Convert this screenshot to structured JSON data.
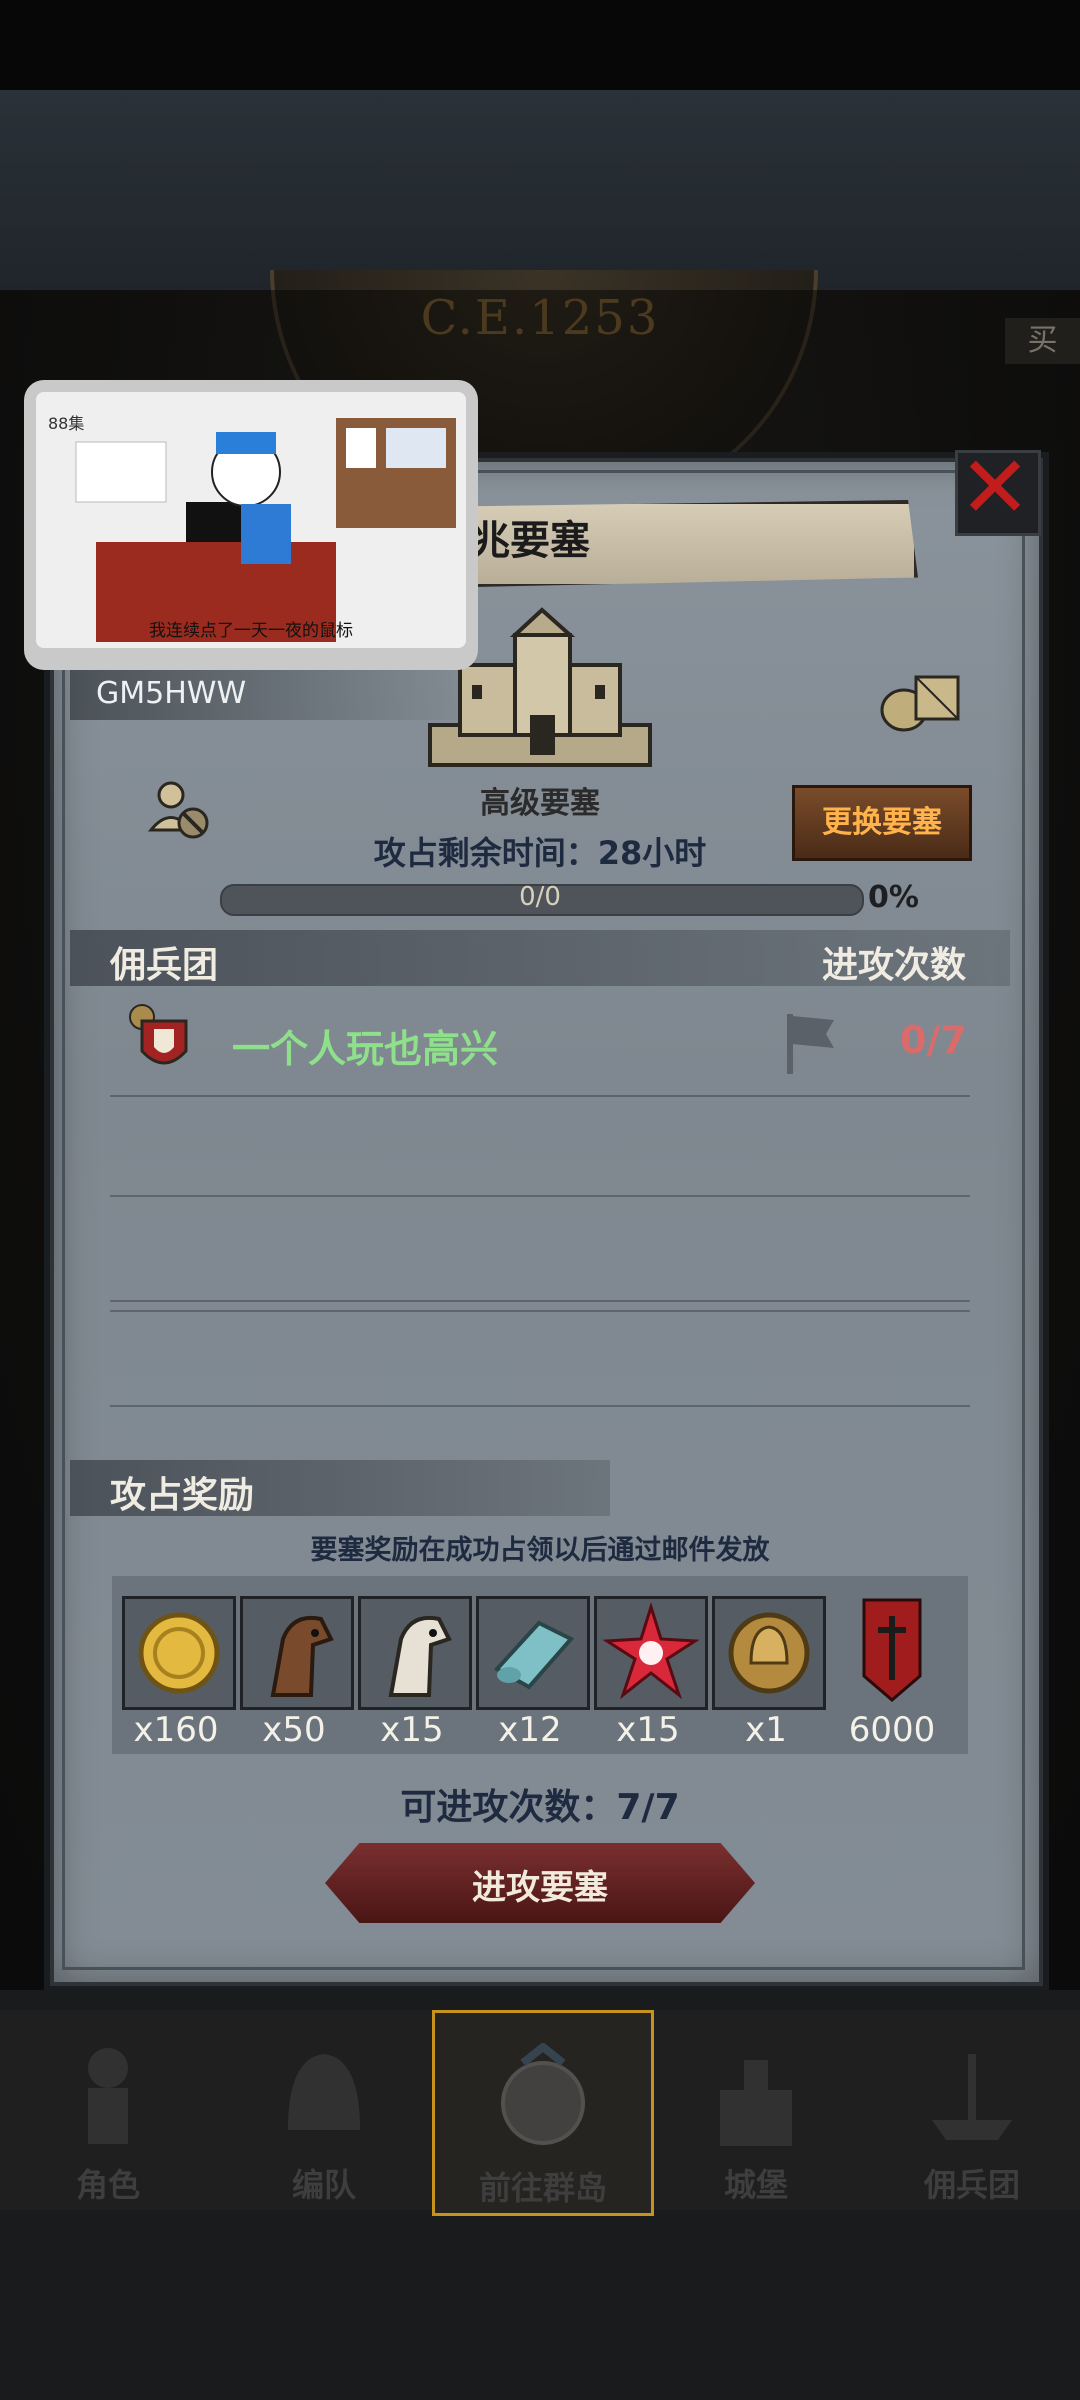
{
  "era": "C.E.1253",
  "side_tab_right": "买",
  "video_overlay": {
    "episode": "88集",
    "subtitle": "我连续点了一天一夜的鼠标"
  },
  "panel": {
    "title": "恶兆要塞",
    "player_id": "GM5HWW",
    "fortress_level": "高级要塞",
    "change_button": "更换要塞",
    "time_remaining": "攻占剩余时间：28小时",
    "progress": {
      "text": "0/0",
      "percent_label": "0%",
      "fraction": 0
    }
  },
  "mercenary_section": {
    "left_header": "佣兵团",
    "right_header": "进攻次数",
    "rows": [
      {
        "name": "一个人玩也高兴",
        "attacks": "0/7"
      }
    ]
  },
  "rewards_section": {
    "header": "攻占奖励",
    "note": "要塞奖励在成功占领以后通过邮件发放",
    "items": [
      {
        "icon": "gold-coin-icon",
        "qty": "x160"
      },
      {
        "icon": "brown-horse-icon",
        "qty": "x50"
      },
      {
        "icon": "white-horse-icon",
        "qty": "x15"
      },
      {
        "icon": "cloth-icon",
        "qty": "x12"
      },
      {
        "icon": "red-star-icon",
        "qty": "x15"
      },
      {
        "icon": "helmet-coin-icon",
        "qty": "x1"
      },
      {
        "icon": "banner-icon",
        "qty": "6000"
      }
    ]
  },
  "attacks_left": "可进攻次数：7/7",
  "attack_button": "进攻要塞",
  "nav": [
    {
      "label": "角色",
      "active": false
    },
    {
      "label": "编队",
      "active": false
    },
    {
      "label": "前往群岛",
      "active": true
    },
    {
      "label": "城堡",
      "active": false
    },
    {
      "label": "佣兵团",
      "active": false
    }
  ],
  "colors": {
    "accent_orange": "#ffb34a",
    "merc_name_green": "#8ee08a",
    "count_red": "#d96b6b",
    "close_red": "#c21c1c"
  }
}
